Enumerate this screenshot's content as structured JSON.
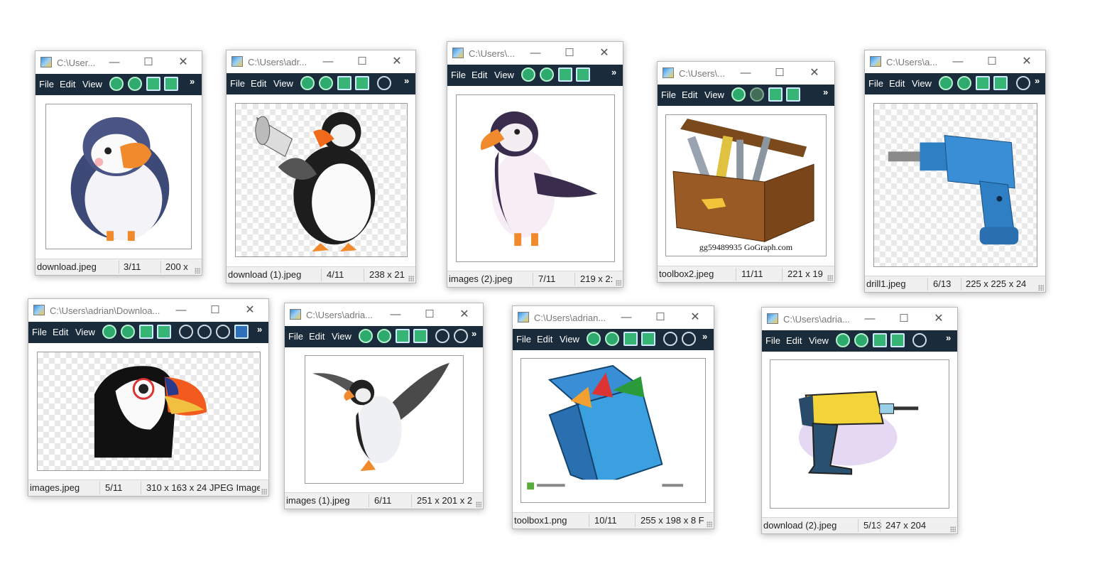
{
  "menus": {
    "file": "File",
    "edit": "Edit",
    "view": "View",
    "more": "»"
  },
  "window_controls": {
    "minimize": "—",
    "maximize": "☐",
    "close": "✕"
  },
  "windows": [
    {
      "title": "C:\\User...",
      "filename": "download.jpeg",
      "index": "3/11",
      "info": "200 x",
      "image": "cartoon puffin"
    },
    {
      "title": "C:\\Users\\adr...",
      "filename": "download (1).jpeg",
      "index": "4/11",
      "info": "238 x 21",
      "image": "puffin with megaphone"
    },
    {
      "title": "C:\\Users\\...",
      "filename": "images (2).jpeg",
      "index": "7/11",
      "info": "219 x 2:",
      "image": "standing puffin"
    },
    {
      "title": "C:\\Users\\...",
      "filename": "toolbox2.jpeg",
      "index": "11/11",
      "info": "221 x 19",
      "image": "wooden toolbox",
      "caption": "gg59489935 GoGraph.com"
    },
    {
      "title": "C:\\Users\\a...",
      "filename": "drill1.jpeg",
      "index": "6/13",
      "info": "225 x 225 x 24",
      "image": "blue power drill"
    },
    {
      "title": "C:\\Users\\adrian\\Downloa...",
      "filename": "images.jpeg",
      "index": "5/11",
      "info": "310 x 163 x 24 JPEG Image",
      "image": "puffin head"
    },
    {
      "title": "C:\\Users\\adria...",
      "filename": "images (1).jpeg",
      "index": "6/11",
      "info": "251 x 201 x 2",
      "image": "flying puffin"
    },
    {
      "title": "C:\\Users\\adrian...",
      "filename": "toolbox1.png",
      "index": "10/11",
      "info": "255 x 198 x 8 F",
      "image": "blue toolbox"
    },
    {
      "title": "C:\\Users\\adria...",
      "filename": "download (2).jpeg",
      "index": "5/13",
      "info": "247 x 204",
      "image": "cartoon drill"
    }
  ],
  "icons": {
    "app": "image-viewer-app-icon",
    "prev": "previous-image-icon",
    "next": "next-image-icon",
    "copy": "copy-icon",
    "paste": "paste-icon",
    "zoom_in": "zoom-in-icon",
    "zoom_out": "zoom-out-icon",
    "zoom_reset": "zoom-reset-icon",
    "fit": "fit-window-icon"
  }
}
